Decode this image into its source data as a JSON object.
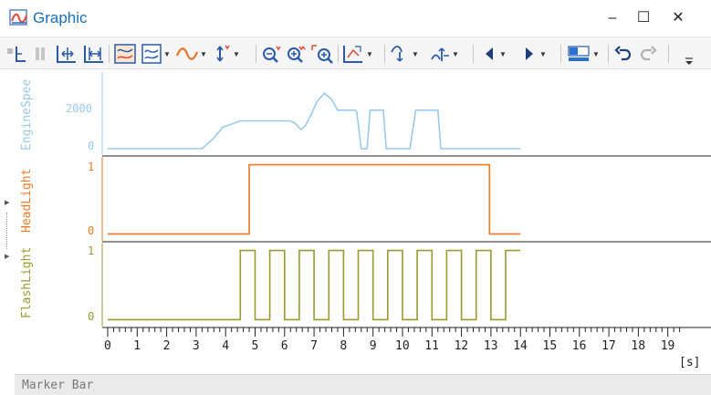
{
  "window": {
    "title": "Graphic",
    "minimize_glyph": "–",
    "maximize_glyph": "☐",
    "close_glyph": "✕"
  },
  "toolbar": {
    "icons": [
      "table-icon",
      "pause-icon",
      "fit-x-icon",
      "fit-xy-icon",
      "signal-layout-icon",
      "signal-layout-2-icon",
      "curve-style-icon",
      "axis-marker-icon",
      "zoom-out-icon",
      "zoom-in-icon",
      "zoom-region-icon",
      "fit-all-icon",
      "measure-1-icon",
      "measure-2-icon",
      "previous-icon",
      "next-icon",
      "color-fill-icon",
      "undo-icon",
      "redo-icon"
    ]
  },
  "signals": [
    {
      "name": "EngineSpee",
      "color": "#99c9ec",
      "ticks": [
        "2000",
        "0"
      ]
    },
    {
      "name": "HeadLight",
      "color": "#ee7a25",
      "ticks": [
        "1",
        "0"
      ]
    },
    {
      "name": "FlashLight",
      "color": "#9a9a2e",
      "ticks": [
        "1",
        "0"
      ]
    }
  ],
  "x_axis": {
    "unit": "[s]",
    "tick_labels": [
      "0",
      "1",
      "2",
      "3",
      "4",
      "5",
      "6",
      "7",
      "8",
      "9",
      "10",
      "11",
      "12",
      "13",
      "14",
      "15",
      "16",
      "17",
      "18",
      "19"
    ],
    "range": [
      0,
      19.5
    ]
  },
  "chart_data": [
    {
      "type": "line",
      "series": [
        {
          "name": "EngineSpee",
          "x": [
            0,
            3.2,
            3.6,
            3.9,
            4.5,
            6.2,
            6.35,
            6.55,
            6.7,
            6.9,
            7.1,
            7.35,
            7.6,
            7.8,
            8.4,
            8.45,
            8.6,
            8.8,
            8.9,
            9.35,
            9.45,
            9.55,
            10.1,
            10.15,
            10.25,
            10.45,
            10.6,
            11.2,
            11.3,
            11.4,
            14
          ],
          "y": [
            0,
            0,
            500,
            1000,
            1300,
            1300,
            1200,
            900,
            1050,
            1600,
            2200,
            2600,
            2300,
            1800,
            1800,
            1700,
            0,
            0,
            1800,
            1800,
            0,
            0,
            0,
            0,
            0,
            1800,
            1800,
            1800,
            0,
            0,
            0
          ]
        }
      ],
      "yticks": [
        0,
        2000
      ],
      "ylim": [
        -300,
        3500
      ]
    },
    {
      "type": "line",
      "series": [
        {
          "name": "HeadLight",
          "x": [
            0,
            4.8,
            4.8,
            12.95,
            12.95,
            14
          ],
          "y": [
            0,
            0,
            1,
            1,
            0,
            0
          ]
        }
      ],
      "yticks": [
        0,
        1
      ],
      "ylim": [
        -0.1,
        1.1
      ]
    },
    {
      "type": "line",
      "series": [
        {
          "name": "FlashLight",
          "x": [
            0,
            4.5,
            4.5,
            5.0,
            5.0,
            5.5,
            5.5,
            6.0,
            6.0,
            6.5,
            6.5,
            7.0,
            7.0,
            7.5,
            7.5,
            8.0,
            8.0,
            8.5,
            8.5,
            9.0,
            9.0,
            9.5,
            9.5,
            10.0,
            10.0,
            10.5,
            10.5,
            11.0,
            11.0,
            11.5,
            11.5,
            12.0,
            12.0,
            12.5,
            12.5,
            13.0,
            13.0,
            13.5,
            13.5,
            14.0
          ],
          "y": [
            0,
            0,
            1,
            1,
            0,
            0,
            1,
            1,
            0,
            0,
            1,
            1,
            0,
            0,
            1,
            1,
            0,
            0,
            1,
            1,
            0,
            0,
            1,
            1,
            0,
            0,
            1,
            1,
            0,
            0,
            1,
            1,
            0,
            0,
            1,
            1,
            0,
            0,
            1,
            1
          ]
        }
      ],
      "yticks": [
        0,
        1
      ],
      "ylim": [
        -0.1,
        1.1
      ]
    }
  ],
  "marker_bar": {
    "label": "Marker Bar"
  }
}
